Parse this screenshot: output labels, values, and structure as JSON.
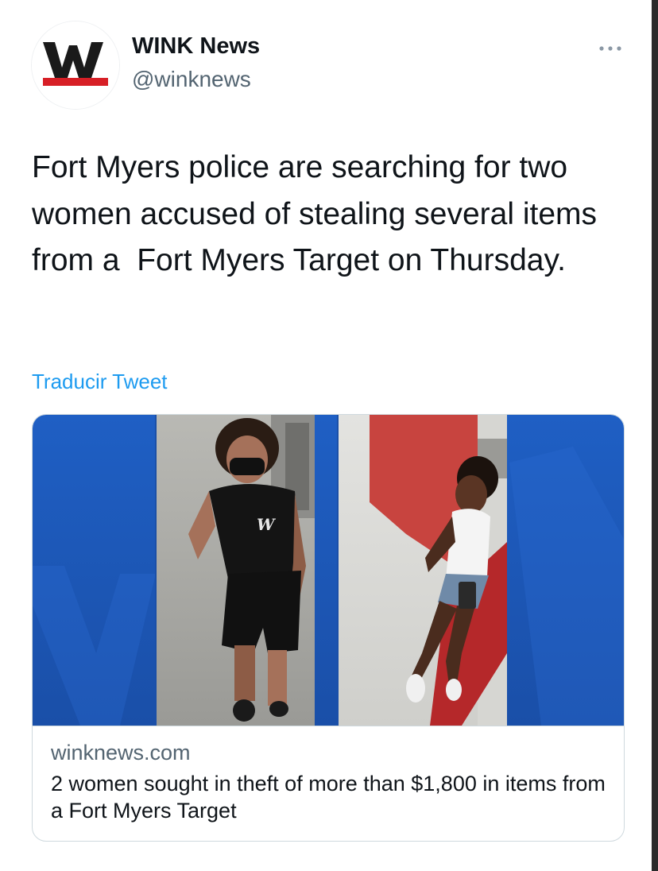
{
  "account": {
    "display_name": "WINK News",
    "handle": "@winknews",
    "avatar_icon": "wink-news-logo",
    "brand_colors": {
      "logo_black": "#1a1a1a",
      "logo_red": "#d71f26"
    }
  },
  "tweet": {
    "text": "Fort Myers police are searching for two women accused of stealing several items from a  Fort Myers Target on Thursday.",
    "translate_label": "Traducir Tweet"
  },
  "link_card": {
    "domain": "winknews.com",
    "title": "2 women sought in theft of more than $1,800 in items from a Fort Myers Target",
    "image_icon": "surveillance-photo-two-women",
    "accent_color": "#1a57b8"
  },
  "colors": {
    "link": "#1d9bf0",
    "text_primary": "#0f1419",
    "text_secondary": "#536471",
    "border": "#cfd9de"
  }
}
